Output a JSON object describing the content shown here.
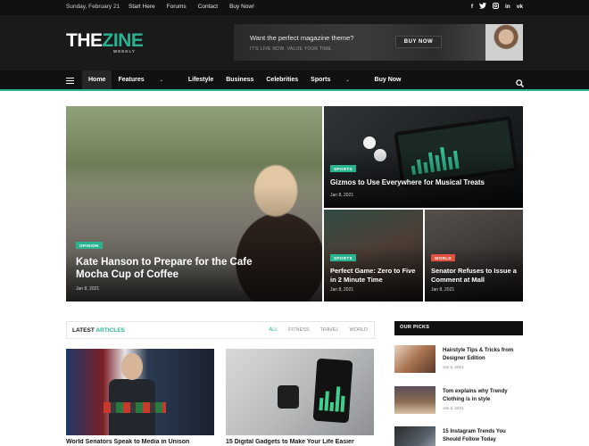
{
  "topbar": {
    "date": "Sunday, February 21",
    "links": [
      "Start Here",
      "Forums",
      "Contact",
      "Buy Now!"
    ],
    "social": [
      "f",
      "t",
      "ig",
      "in",
      "vk"
    ]
  },
  "header": {
    "logo_main": "THE",
    "logo_accent": "ZINE",
    "logo_sub": "WEEKLY",
    "ad": {
      "headline": "Want the perfect magazine theme?",
      "sub": "IT'S LIVE NOW, VALUE YOUR TIME.",
      "button": "BUY NOW"
    }
  },
  "nav": {
    "items": [
      {
        "label": "Home",
        "dropdown": false
      },
      {
        "label": "Features",
        "dropdown": true
      },
      {
        "label": "Lifestyle",
        "dropdown": false
      },
      {
        "label": "Business",
        "dropdown": false
      },
      {
        "label": "Celebrities",
        "dropdown": false
      },
      {
        "label": "Sports",
        "dropdown": true
      },
      {
        "label": "Buy Now",
        "dropdown": false
      }
    ],
    "chevron": "⌄"
  },
  "hero": {
    "main": {
      "category": "OPINION",
      "title_line1": "Kate Hanson to Prepare for the Cafe",
      "title_line2": "Mocha Cup of Coffee",
      "date": "Jan 8, 2021"
    },
    "top_right": {
      "category": "SPORTS",
      "title": "Gizmos to Use Everywhere for Musical Treats",
      "date": "Jan 8, 2021"
    },
    "bottom_left": {
      "category": "SPORTS",
      "title_line1": "Perfect Game: Zero to Five",
      "title_line2": "in 2 Minute Time",
      "date": "Jan 8, 2021"
    },
    "bottom_right": {
      "category": "WORLD",
      "title_line1": "Senator Refuses to Issue a",
      "title_line2": "Comment at Mall",
      "date": "Jan 8, 2021"
    }
  },
  "latest": {
    "label_main": "LATEST",
    "label_accent": "ARTICLES",
    "filters": [
      "ALL",
      "FITNESS",
      "TRAVEL",
      "WORLD"
    ],
    "cards": [
      {
        "title": "World Senators Speak to Media in Unison"
      },
      {
        "title": "15 Digital Gadgets to Make Your Life Easier"
      }
    ]
  },
  "sidebar": {
    "heading": "OUR PICKS",
    "picks": [
      {
        "title_line1": "Hairstyle Tips & Tricks from",
        "title_line2": "Designer Edition",
        "date": "Jan 6, 2021"
      },
      {
        "title_line1": "Tom explains why Trendy",
        "title_line2": "Clothing is in style",
        "date": "Jan 6, 2021"
      },
      {
        "title_line1": "15 Instagram Trends You",
        "title_line2": "Should Follow Today",
        "date": ""
      }
    ]
  },
  "colors": {
    "accent": "#2ab391",
    "dark": "#111111",
    "header": "#1a1a1a",
    "world_badge": "#e0523f"
  }
}
